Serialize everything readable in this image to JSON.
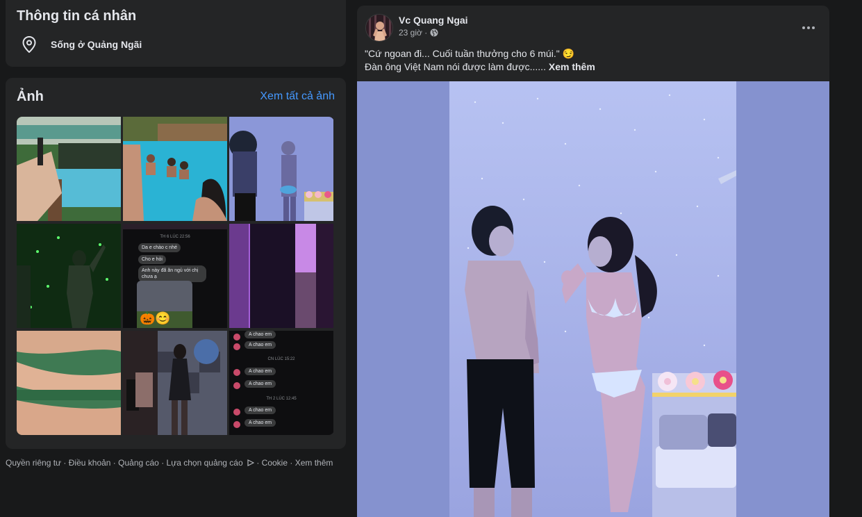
{
  "intro": {
    "title": "Thông tin cá nhân",
    "location_icon": "location-pin-icon",
    "location": "Sống ở Quảng Ngãi"
  },
  "photos": {
    "title": "Ảnh",
    "see_all": "Xem tất cả ảnh",
    "screenshot_chat1": {
      "date": "TH 6 LÚC 22:56",
      "msg1": "Da e chào c nhé",
      "msg2": "Cho e hỏi",
      "msg3": "Anh này đã ăn ngủ với chị chưa ạ"
    },
    "screenshot_chat2": {
      "msg": "A chao em",
      "date1": "CN LÚC 15:22",
      "date2": "TH 2 LÚC 12:45"
    }
  },
  "footer": {
    "privacy": "Quyền riêng tư",
    "terms": "Điều khoản",
    "ads": "Quảng cáo",
    "ad_choices": "Lựa chọn quảng cáo",
    "ad_choices_icon": "adchoices-icon",
    "cookie": "Cookie",
    "more": "Xem thêm",
    "sep": " · "
  },
  "post": {
    "author": "Vc Quang Ngai",
    "time": "23 giờ",
    "dot": " · ",
    "privacy_icon": "globe-icon",
    "more_icon": "more-dots-icon",
    "line1": "\"Cứ ngoan đi... Cuối tuần thưởng cho 6 múi.\"",
    "line1_emoji": "😏",
    "line2": "Đàn ông Việt Nam nói được làm được......",
    "see_more": "Xem thêm"
  },
  "colors": {
    "background": "#18191a",
    "card": "#242526",
    "link": "#4599ff",
    "secondary_text": "#b0b3b8"
  }
}
